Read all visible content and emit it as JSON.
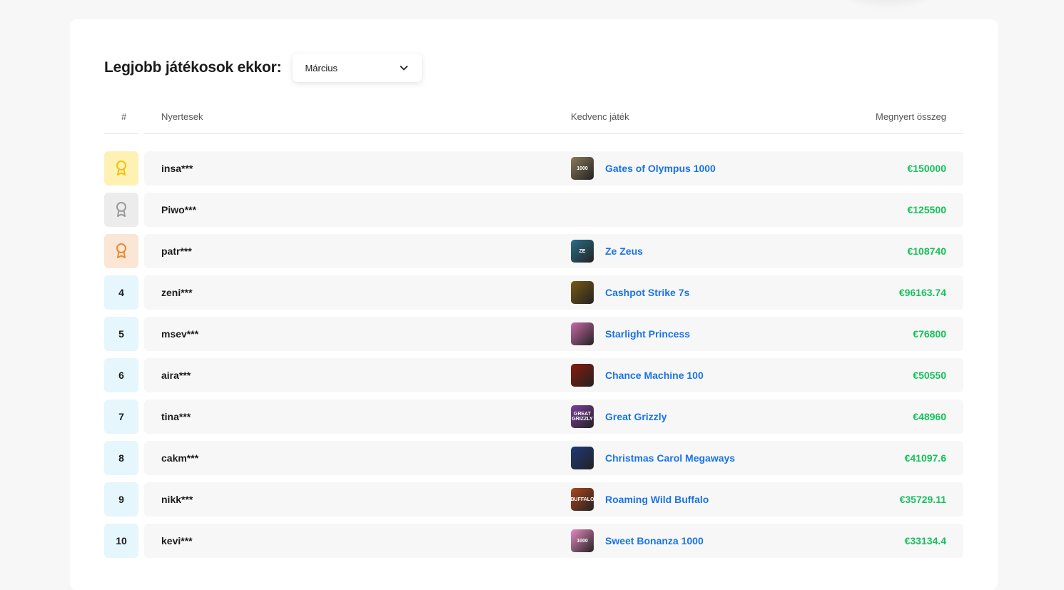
{
  "leaderboard": {
    "heading": "Legjobb játékosok ekkor:",
    "month_select": {
      "value": "Március"
    },
    "columns": {
      "rank": "#",
      "winners": "Nyertesek",
      "favorite_game": "Kedvenc játék",
      "amount": "Megnyert összeg"
    },
    "rows": [
      {
        "rank": "",
        "medal": "gold",
        "medal_icon": "award-gold-icon",
        "player": "insa***",
        "game": "Gates of Olympus 1000",
        "thumb_color": "#8a7a5a",
        "thumb_label": "1000",
        "amount": "€150000"
      },
      {
        "rank": "",
        "medal": "silver",
        "medal_icon": "award-silver-icon",
        "player": "Piwo***",
        "game": "",
        "thumb_color": "",
        "thumb_label": "",
        "amount": "€125500"
      },
      {
        "rank": "",
        "medal": "bronze",
        "medal_icon": "award-bronze-icon",
        "player": "patr***",
        "game": "Ze Zeus",
        "thumb_color": "#2a6f8a",
        "thumb_label": "ZE",
        "amount": "€108740"
      },
      {
        "rank": "4",
        "medal": "",
        "player": "zeni***",
        "game": "Cashpot Strike 7s",
        "thumb_color": "#7a5a12",
        "thumb_label": "",
        "amount": "€96163.74"
      },
      {
        "rank": "5",
        "medal": "",
        "player": "msev***",
        "game": "Starlight Princess",
        "thumb_color": "#c86aa8",
        "thumb_label": "",
        "amount": "€76800"
      },
      {
        "rank": "6",
        "medal": "",
        "player": "aira***",
        "game": "Chance Machine 100",
        "thumb_color": "#8a1a0a",
        "thumb_label": "",
        "amount": "€50550"
      },
      {
        "rank": "7",
        "medal": "",
        "player": "tina***",
        "game": "Great Grizzly",
        "thumb_color": "#7a3ea0",
        "thumb_label": "GREAT GRIZZLY",
        "amount": "€48960"
      },
      {
        "rank": "8",
        "medal": "",
        "player": "cakm***",
        "game": "Christmas Carol Megaways",
        "thumb_color": "#1e3a7a",
        "thumb_label": "",
        "amount": "€41097.6"
      },
      {
        "rank": "9",
        "medal": "",
        "player": "nikk***",
        "game": "Roaming Wild Buffalo",
        "thumb_color": "#b0461a",
        "thumb_label": "BUFFALO",
        "amount": "€35729.11"
      },
      {
        "rank": "10",
        "medal": "",
        "player": "kevi***",
        "game": "Sweet Bonanza 1000",
        "thumb_color": "#e88ac0",
        "thumb_label": "1000",
        "amount": "€33134.4"
      }
    ]
  },
  "colors": {
    "gold": "#fdf2b4",
    "gold_icon": "#f2c10a",
    "silver": "#ececec",
    "silver_icon": "#9a9a9a",
    "bronze": "#fbe6d6",
    "bronze_icon": "#e88a2e",
    "rank_bg": "#e5f6fd",
    "game_link": "#1a73e8",
    "amount": "#16c15b"
  }
}
